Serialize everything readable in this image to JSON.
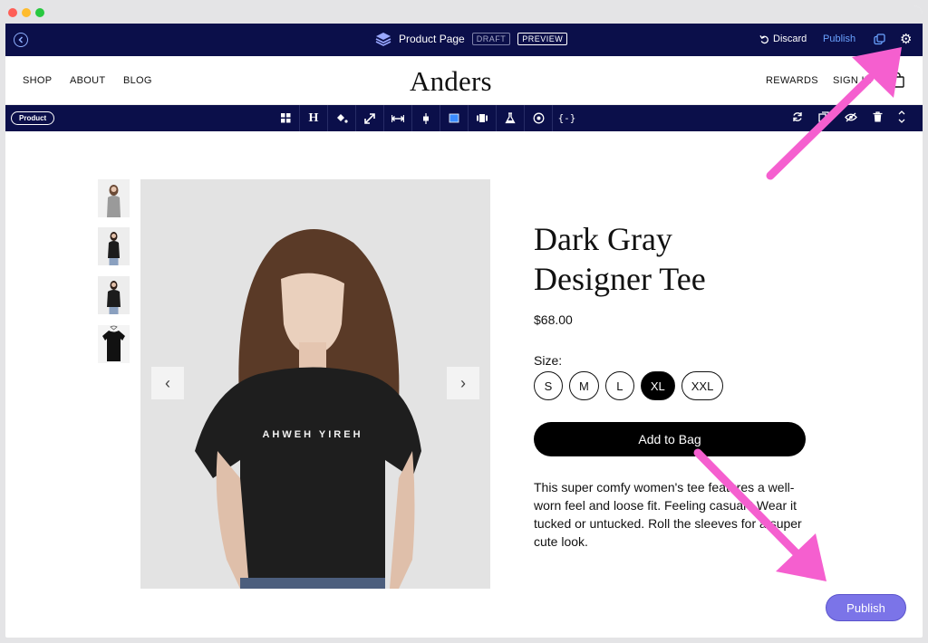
{
  "editor": {
    "page_name": "Product Page",
    "draft_badge": "DRAFT",
    "preview_badge": "PREVIEW",
    "discard_label": "Discard",
    "publish_link": "Publish"
  },
  "site": {
    "nav_left": [
      "SHOP",
      "ABOUT",
      "BLOG"
    ],
    "logo": "Anders",
    "nav_right": [
      "REWARDS",
      "SIGN IN"
    ]
  },
  "toolbar": {
    "context_label": "Product",
    "tools": [
      "grid-icon",
      "heading-icon",
      "paint-bucket-icon",
      "resize-icon",
      "width-icon",
      "align-icon",
      "block-icon",
      "carousel-icon",
      "flask-icon",
      "target-icon",
      "code-icon"
    ],
    "right_tools": [
      "refresh-icon",
      "duplicate-icon",
      "hide-icon",
      "trash-icon",
      "reorder-icon"
    ]
  },
  "product": {
    "title_line1": "Dark Gray",
    "title_line2": "Designer Tee",
    "price": "$68.00",
    "size_label": "Size:",
    "sizes": [
      "S",
      "M",
      "L",
      "XL",
      "XXL"
    ],
    "selected_size": "XL",
    "add_to_bag": "Add to Bag",
    "description": "This super comfy women's tee features a well-worn feel and loose fit. Feeling casual? Wear it tucked or untucked. Roll the sleeves for a super cute look.",
    "shirt_print": "AHWEH  YIREH"
  },
  "publish_button": "Publish",
  "colors": {
    "editor_bar": "#0b0f4a",
    "publish_button": "#7b74e8",
    "annotation_arrow": "#f55fcf"
  }
}
